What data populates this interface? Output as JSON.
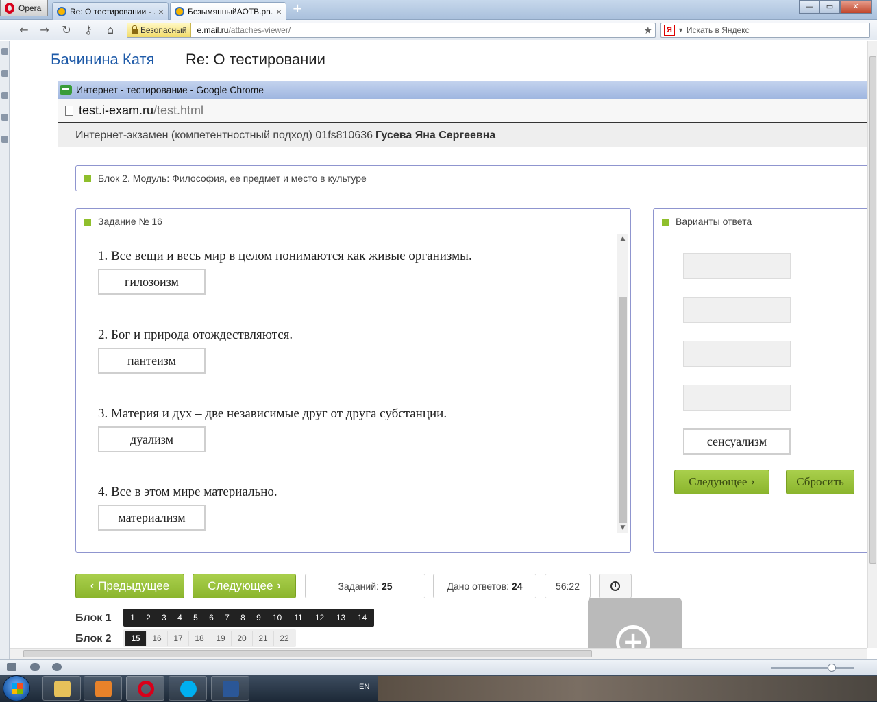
{
  "opera": {
    "menu_label": "Opera",
    "tabs": [
      {
        "title": "Re: О тестировании - ...",
        "active": false
      },
      {
        "title": "БезымянныйАОТВ.pn...",
        "active": true
      }
    ],
    "new_tab": "+",
    "window_controls": {
      "minimize": "—",
      "maximize": "▭",
      "close": "✕"
    }
  },
  "address_bar": {
    "security_label": "Безопасный",
    "url_domain": "e.mail.ru",
    "url_path": "/attaches-viewer/",
    "search_placeholder": "Искать в Яндекс",
    "search_engine_letter": "Я"
  },
  "viewer": {
    "sender": "Бачинина Катя",
    "subject": "Re: О тестировании"
  },
  "chrome": {
    "title": "Интернет - тестирование - Google Chrome",
    "url_domain": "test.i-exam.ru",
    "url_path": "/test.html"
  },
  "exam": {
    "header_text": "Интернет-экзамен (компетентностный подход) 01fs810636",
    "student_name": "Гусева Яна Сергеевна",
    "block_title": "Блок 2. Модуль: Философия, ее предмет и место в культуре",
    "task_title": "Задание № 16",
    "questions": [
      {
        "text": "1. Все вещи и весь мир в целом понимаются как живые организмы.",
        "answer": "гилозоизм"
      },
      {
        "text": "2. Бог и природа отождествляются.",
        "answer": "пантеизм"
      },
      {
        "text": "3. Материя и дух – две независимые друг от друга субстанции.",
        "answer": "дуализм"
      },
      {
        "text": "4. Все в этом мире материально.",
        "answer": "материализм"
      }
    ],
    "answers_title": "Варианты ответа",
    "answer_options": [
      "",
      "",
      "",
      "",
      "сенсуализм"
    ],
    "next_answer_label": "Следующее",
    "reset_label": "Сбросить",
    "prev_label": "Предыдущее",
    "next_label": "Следующее",
    "tasks_label": "Заданий:",
    "tasks_count": "25",
    "answered_label": "Дано ответов:",
    "answered_count": "24",
    "timer": "56:22",
    "block1_label": "Блок 1",
    "block1_numbers": [
      "1",
      "2",
      "3",
      "4",
      "5",
      "6",
      "7",
      "8",
      "9",
      "10",
      "11",
      "12",
      "13",
      "14"
    ],
    "block2_label": "Блок 2",
    "block2_numbers": [
      "15",
      "16",
      "17",
      "18",
      "19",
      "20",
      "21",
      "22"
    ],
    "current_task": "15"
  },
  "taskbar": {
    "language": "EN"
  }
}
